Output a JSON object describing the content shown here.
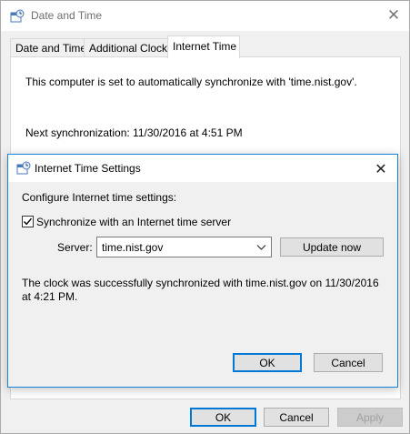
{
  "window": {
    "title": "Date and Time",
    "close_icon": "close-icon"
  },
  "tabs": [
    {
      "label": "Date and Time",
      "active": false
    },
    {
      "label": "Additional Clocks",
      "active": false
    },
    {
      "label": "Internet Time",
      "active": true
    }
  ],
  "internet_time": {
    "status_text": "This computer is set to automatically synchronize with 'time.nist.gov'.",
    "next_sync_text": "Next synchronization: 11/30/2016 at 4:51 PM"
  },
  "footer": {
    "ok_label": "OK",
    "cancel_label": "Cancel",
    "apply_label": "Apply"
  },
  "dialog": {
    "title": "Internet Time Settings",
    "configure_label": "Configure Internet time settings:",
    "sync_checkbox_label": "Synchronize with an Internet time server",
    "sync_checked": true,
    "server_label": "Server:",
    "server_value": "time.nist.gov",
    "update_now_label": "Update now",
    "result_line1": "The clock was successfully synchronized with time.nist.gov on 11/30/2016",
    "result_line2": "at 4:21 PM.",
    "ok_label": "OK",
    "cancel_label": "Cancel"
  },
  "colors": {
    "accent": "#0078d7",
    "dialog_border": "#1883d7"
  }
}
